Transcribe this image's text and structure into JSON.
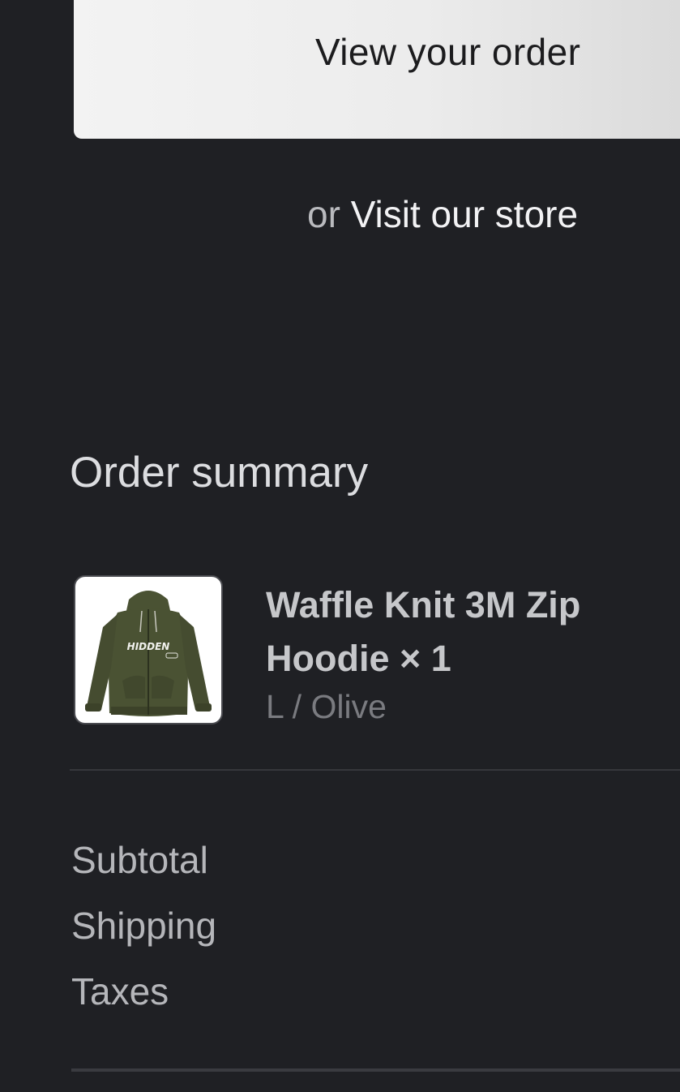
{
  "actions": {
    "view_order_label": "View your order",
    "alt_prefix": "or",
    "visit_store_label": "Visit our store"
  },
  "order_summary": {
    "title": "Order summary",
    "items": [
      {
        "name": "Waffle Knit 3M Zip Hoodie × 1",
        "variant": "L / Olive",
        "image_icon": "hoodie-thumbnail",
        "image_text": "HIDDEN"
      }
    ],
    "costs": [
      {
        "label": "Subtotal"
      },
      {
        "label": "Shipping"
      },
      {
        "label": "Taxes"
      }
    ]
  },
  "colors": {
    "background": "#1f2024",
    "button": "#ececec",
    "hoodie": "#4a5233"
  }
}
